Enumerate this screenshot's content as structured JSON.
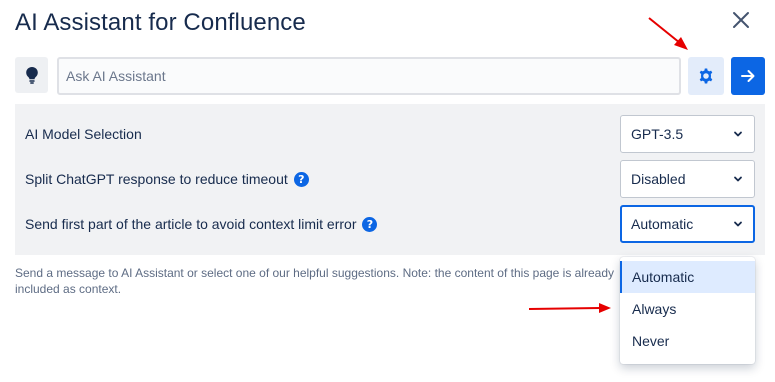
{
  "dialog": {
    "title": "AI Assistant for Confluence",
    "close_icon": "close-icon"
  },
  "prompt": {
    "placeholder": "Ask AI Assistant",
    "value": "",
    "bulb_icon": "lightbulb-icon",
    "settings_icon": "gear-icon",
    "send_icon": "arrow-right-icon"
  },
  "settings": [
    {
      "label": "AI Model Selection",
      "value": "GPT-3.5",
      "has_help": false
    },
    {
      "label": "Split ChatGPT response to reduce timeout",
      "value": "Disabled",
      "has_help": true
    },
    {
      "label": "Send first part of the article to avoid context limit error",
      "value": "Automatic",
      "has_help": true
    }
  ],
  "note": "Send a message to AI Assistant or select one of our helpful suggestions. Note: the content of this page is already included as context.",
  "dropdown": {
    "options": [
      "Automatic",
      "Always",
      "Never"
    ],
    "selected": "Automatic"
  },
  "colors": {
    "accent": "#0c66e4",
    "annotation_arrow": "#e60000",
    "panel_bg": "#f1f2f4",
    "selected_option_bg": "#deebff"
  }
}
